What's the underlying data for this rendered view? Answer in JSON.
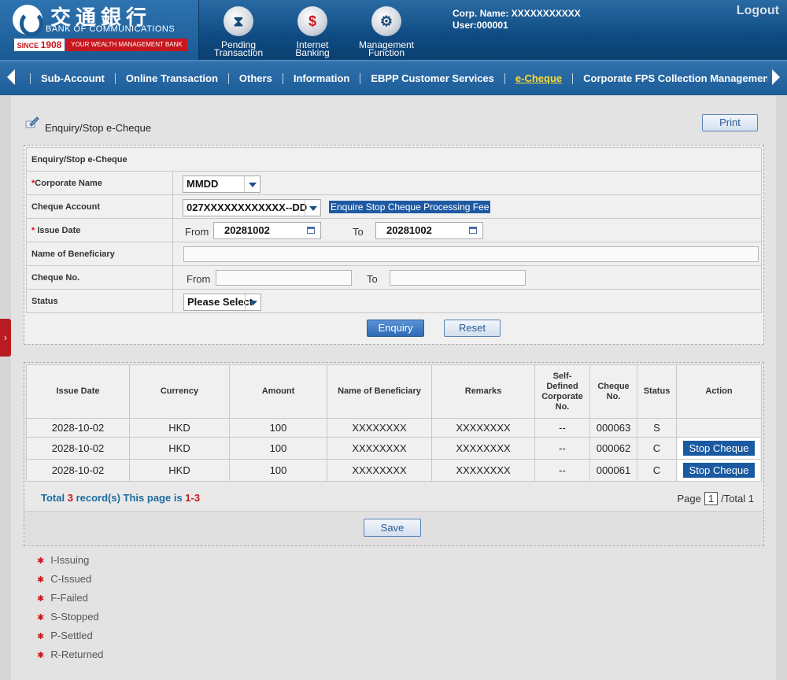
{
  "header": {
    "bank_name_cn": "交通銀行",
    "bank_name_en": "BANK OF COMMUNICATIONS",
    "since_label": "SINCE",
    "since_year": "1908",
    "slogan": "YOUR WEALTH MANAGEMENT BANK",
    "icons": [
      {
        "line1": "Pending",
        "line2": "Transaction",
        "icon": "hourglass-icon"
      },
      {
        "line1": "Internet",
        "line2": "Banking",
        "icon": "monitor-dollar-icon"
      },
      {
        "line1": "Management",
        "line2": "Function",
        "icon": "gears-icon"
      }
    ],
    "corp_name": "Corp. Name: XXXXXXXXXXX",
    "user": "User:000001",
    "logout": "Logout"
  },
  "nav": {
    "items": [
      "Sub-Account",
      "Online Transaction",
      "Others",
      "Information",
      "EBPP Customer Services",
      "e-Cheque",
      "Corporate FPS Collection Management S"
    ],
    "active_index": 5
  },
  "page": {
    "title": "Enquiry/Stop e-Cheque",
    "print": "Print"
  },
  "form": {
    "section_title": "Enquiry/Stop e-Cheque",
    "corporate_name_label": "Corporate Name",
    "corporate_name_value": "MMDD",
    "cheque_account_label": "Cheque Account",
    "cheque_account_value": "027XXXXXXXXXXXX--DD",
    "fee_link": "Enquire Stop Cheque Processing Fee",
    "issue_date_label": "Issue Date",
    "from_label": "From",
    "to_label": "To",
    "issue_date_from": "20281002",
    "issue_date_to": "20281002",
    "beneficiary_label": "Name of Beneficiary",
    "cheque_no_label": "Cheque No.",
    "status_label": "Status",
    "status_value": "Please Select",
    "enquiry": "Enquiry",
    "reset": "Reset"
  },
  "results": {
    "headers": [
      "Issue Date",
      "Currency",
      "Amount",
      "Name of Beneficiary",
      "Remarks",
      "Self-Defined Corporate No.",
      "Cheque No.",
      "Status",
      "Action"
    ],
    "rows": [
      {
        "date": "2028-10-02",
        "currency": "HKD",
        "amount": "100",
        "beneficiary": "XXXXXXXX",
        "remarks": "XXXXXXXX",
        "corp_no": "--",
        "cheque_no": "000063",
        "status": "S",
        "action": ""
      },
      {
        "date": "2028-10-02",
        "currency": "HKD",
        "amount": "100",
        "beneficiary": "XXXXXXXX",
        "remarks": "XXXXXXXX",
        "corp_no": "--",
        "cheque_no": "000062",
        "status": "C",
        "action": "Stop Cheque"
      },
      {
        "date": "2028-10-02",
        "currency": "HKD",
        "amount": "100",
        "beneficiary": "XXXXXXXX",
        "remarks": "XXXXXXXX",
        "corp_no": "--",
        "cheque_no": "000061",
        "status": "C",
        "action": "Stop Cheque"
      }
    ],
    "total_prefix": "Total",
    "total_count": "3",
    "total_mid": "record(s) This page is",
    "total_range": "1-3",
    "page_label": "Page",
    "page_current": "1",
    "page_total": "/Total 1",
    "save": "Save"
  },
  "legend": [
    "I-Issuing",
    "C-Issued",
    "F-Failed",
    "S-Stopped",
    "P-Settled",
    "R-Returned"
  ]
}
